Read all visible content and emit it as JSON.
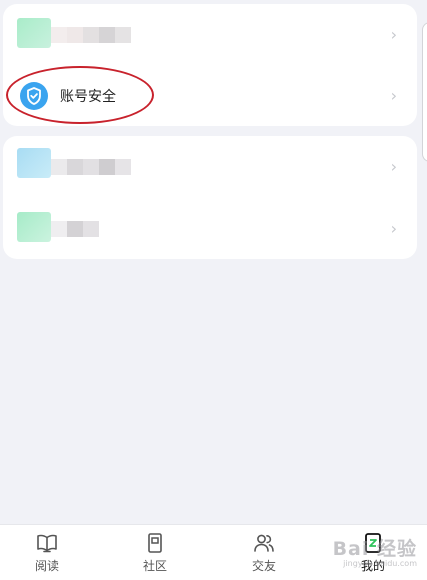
{
  "menu": {
    "account_security_label": "账号安全"
  },
  "tabbar": {
    "tabs": [
      {
        "label": "阅读",
        "icon": "book-open-icon"
      },
      {
        "label": "社区",
        "icon": "community-icon"
      },
      {
        "label": "交友",
        "icon": "friends-icon"
      },
      {
        "label": "我的",
        "icon": "profile-icon"
      }
    ],
    "active_index": 3
  },
  "watermark": {
    "main": "Bai 经验",
    "sub": "jingyan.baidu.com"
  },
  "colors": {
    "background": "#f1f2f7",
    "card": "#ffffff",
    "accent_blue": "#3aa4ef",
    "annotation_red": "#c8222c"
  }
}
